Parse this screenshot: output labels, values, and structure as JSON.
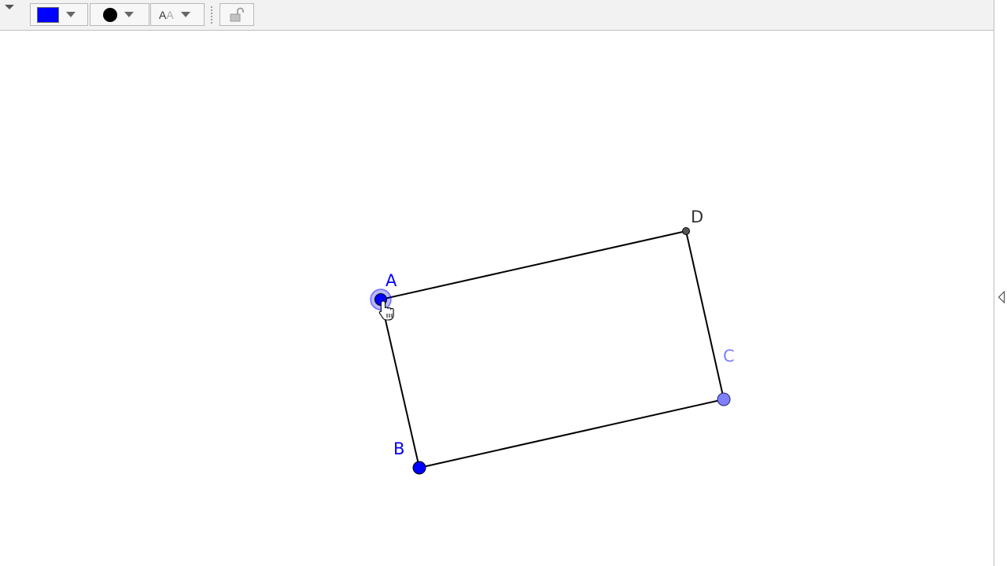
{
  "toolbar": {
    "menu_toggle_icon": "triangle-down-icon",
    "object_color": "#0000ff",
    "point_style_icon": "filled-dot-icon",
    "label_style_icon": "text-size-aa-icon",
    "label_icon_text": [
      "A",
      "A"
    ],
    "lock_icon": "unlocked-padlock-icon"
  },
  "side_panel": {
    "toggle_icon": "triangle-left-icon"
  },
  "geometry": {
    "points": [
      {
        "name": "A",
        "color": "#0000ff",
        "selected": true
      },
      {
        "name": "B",
        "color": "#0000ff",
        "selected": false
      },
      {
        "name": "C",
        "color": "#8080ff",
        "selected": false
      },
      {
        "name": "D",
        "color": "#333333",
        "selected": false
      }
    ],
    "polygon_stroke": "#000000",
    "cursor_icon": "hand-pointer-icon"
  }
}
